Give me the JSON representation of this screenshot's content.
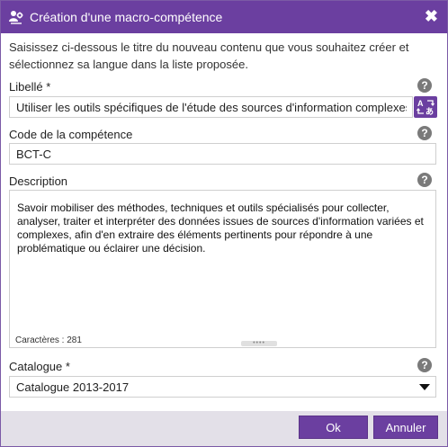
{
  "dialog": {
    "title": "Création d'une macro-compétence",
    "close_symbol": "✖",
    "intro": "Saisissez ci-dessous le titre du nouveau contenu que vous souhaitez créer et sélectionnez sa langue dans la liste proposée."
  },
  "fields": {
    "libelle": {
      "label": "Libellé *",
      "value": "Utiliser les outils spécifiques de l'étude des sources d'information complexes"
    },
    "code": {
      "label": "Code de la compétence",
      "value": "BCT-C"
    },
    "description": {
      "label": "Description",
      "value": "Savoir mobiliser des méthodes, techniques et outils spécialisés pour collecter, analyser, traiter et interpréter des données issues de sources d'information variées et complexes, afin d'en extraire des éléments pertinents pour répondre à une problématique ou éclairer une décision.",
      "counter": "Caractères : 281",
      "grip": "••••"
    },
    "catalogue": {
      "label": "Catalogue *",
      "selected": "Catalogue 2013-2017"
    }
  },
  "help_symbol": "?",
  "buttons": {
    "ok": "Ok",
    "cancel": "Annuler"
  },
  "colors": {
    "accent": "#6b3fa0",
    "footer_bg": "#e3e0e8",
    "help_icon": "#7a7a7a"
  },
  "icons": {
    "title": "macro-competence-icon",
    "translate": "translate-icon",
    "help": "help-icon",
    "dropdown": "chevron-down-icon",
    "close": "close-icon"
  }
}
